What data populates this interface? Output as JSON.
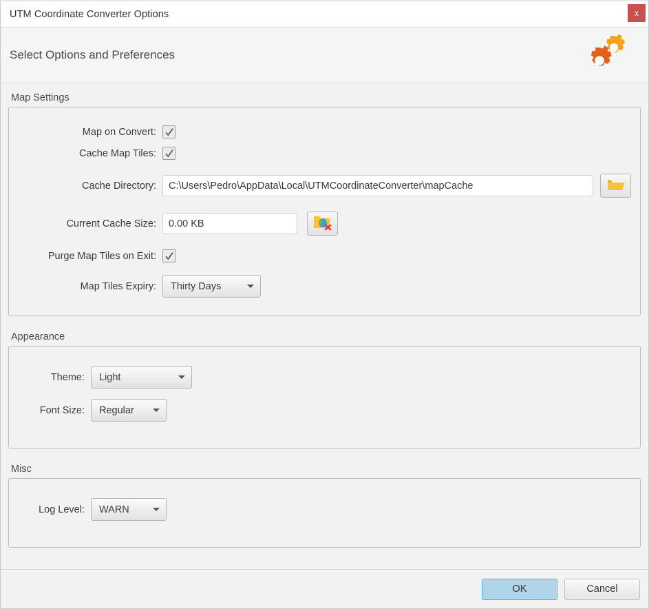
{
  "window": {
    "title": "UTM Coordinate Converter Options",
    "close_label": "x"
  },
  "header": {
    "title": "Select Options and Preferences",
    "icon": "gears-icon"
  },
  "sections": {
    "map_settings": {
      "title": "Map Settings",
      "map_on_convert": {
        "label": "Map on Convert:",
        "checked": true
      },
      "cache_map_tiles": {
        "label": "Cache Map Tiles:",
        "checked": true
      },
      "cache_directory": {
        "label": "Cache Directory:",
        "value": "C:\\Users\\Pedro\\AppData\\Local\\UTMCoordinateConverter\\mapCache",
        "browse_icon": "folder-icon"
      },
      "current_cache_size": {
        "label": "Current Cache Size:",
        "value": "0.00 KB",
        "clear_icon": "folder-globe-delete-icon"
      },
      "purge_on_exit": {
        "label": "Purge Map Tiles on Exit:",
        "checked": true
      },
      "map_tiles_expiry": {
        "label": "Map Tiles Expiry:",
        "value": "Thirty Days",
        "options": [
          "Thirty Days"
        ]
      }
    },
    "appearance": {
      "title": "Appearance",
      "theme": {
        "label": "Theme:",
        "value": "Light",
        "options": [
          "Light"
        ]
      },
      "font_size": {
        "label": "Font Size:",
        "value": "Regular",
        "options": [
          "Regular"
        ]
      }
    },
    "misc": {
      "title": "Misc",
      "log_level": {
        "label": "Log Level:",
        "value": "WARN",
        "options": [
          "WARN"
        ]
      }
    }
  },
  "footer": {
    "ok_label": "OK",
    "cancel_label": "Cancel"
  },
  "colors": {
    "accent_blue": "#aed5ea",
    "close_red": "#c7514f",
    "gear_orange_light": "#f5a11a",
    "gear_orange_dark": "#e3601a",
    "folder_yellow": "#f7c13b"
  }
}
